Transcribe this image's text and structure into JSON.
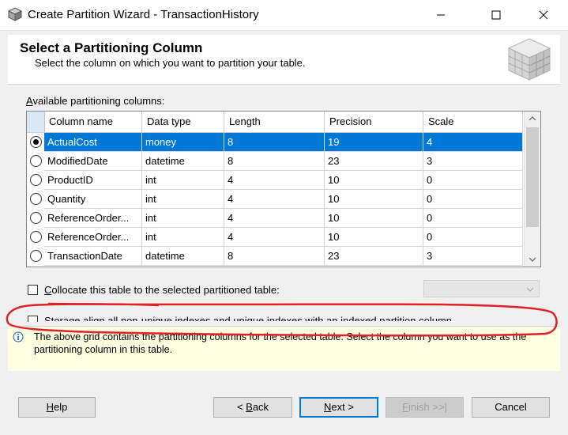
{
  "window": {
    "title": "Create Partition Wizard - TransactionHistory"
  },
  "header": {
    "title": "Select a Partitioning Column",
    "subtitle": "Select the column on which you want to partition your table."
  },
  "grid": {
    "label_prefix": "",
    "label_accel": "A",
    "label_rest": "vailable partitioning columns:",
    "columns": [
      "Column name",
      "Data type",
      "Length",
      "Precision",
      "Scale"
    ],
    "rows": [
      [
        "ActualCost",
        "money",
        "8",
        "19",
        "4"
      ],
      [
        "ModifiedDate",
        "datetime",
        "8",
        "23",
        "3"
      ],
      [
        "ProductID",
        "int",
        "4",
        "10",
        "0"
      ],
      [
        "Quantity",
        "int",
        "4",
        "10",
        "0"
      ],
      [
        "ReferenceOrder...",
        "int",
        "4",
        "10",
        "0"
      ],
      [
        "ReferenceOrder...",
        "int",
        "4",
        "10",
        "0"
      ],
      [
        "TransactionDate",
        "datetime",
        "8",
        "23",
        "3"
      ]
    ],
    "selected_index": 0
  },
  "collocate": {
    "accel": "C",
    "rest": "ollocate this table to the selected partitioned table:",
    "checked": false
  },
  "storage": {
    "label": "Storage align all non-unique indexes and unique indexes with an indexed partition column",
    "checked": false
  },
  "info": {
    "text": "The above grid contains the partitioning columns for the selected table. Select the column you want to use as the partitioning column in this table."
  },
  "buttons": {
    "help": {
      "accel": "H",
      "rest": "elp"
    },
    "back": {
      "pre": "< ",
      "accel": "B",
      "rest": "ack"
    },
    "next": {
      "accel": "N",
      "rest": "ext >"
    },
    "finish": {
      "accel": "F",
      "rest": "inish >>|"
    },
    "cancel": "Cancel"
  },
  "colors": {
    "selection": "#0078d7",
    "annotation": "#e0202a",
    "info_bg": "#ffffe1"
  }
}
